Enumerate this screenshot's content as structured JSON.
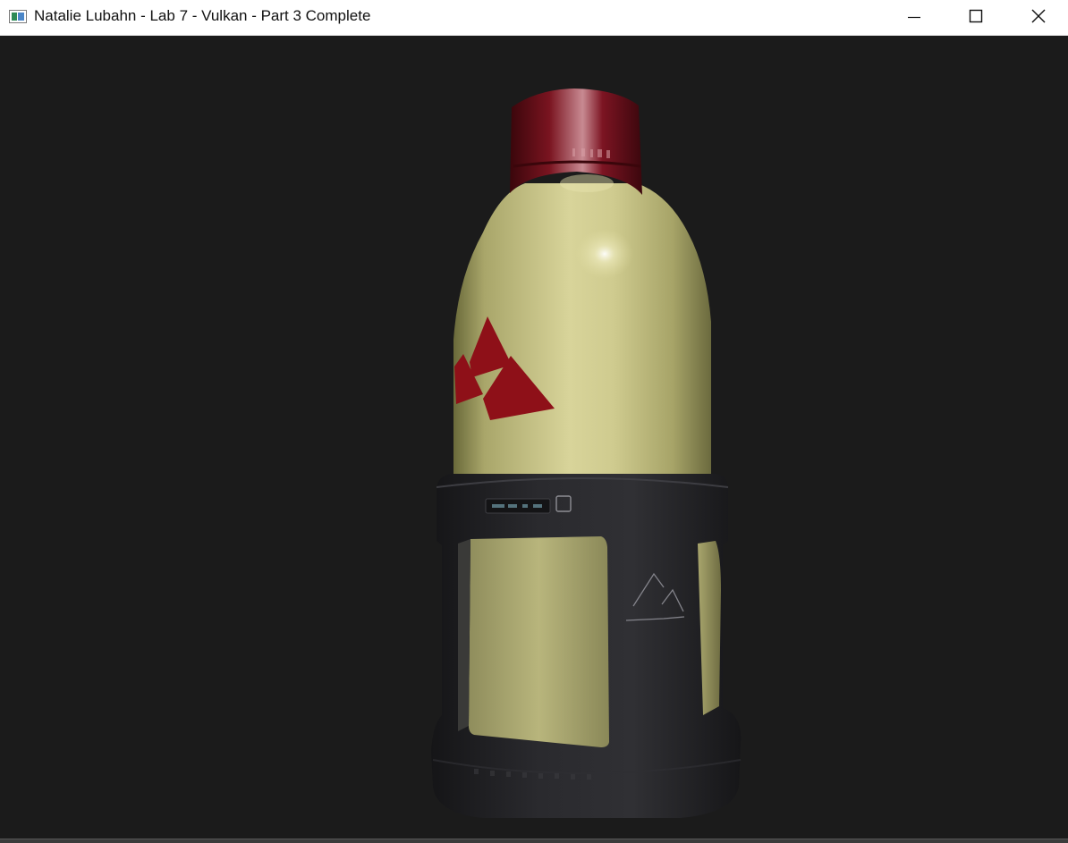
{
  "window": {
    "title": "Natalie Lubahn - Lab 7 - Vulkan - Part 3 Complete",
    "icon": "app-window-icon",
    "controls": {
      "minimize_icon": "minimize-icon",
      "maximize_icon": "maximize-icon",
      "close_icon": "close-icon"
    }
  },
  "viewport": {
    "background_color": "#1b1b1b",
    "model": {
      "object": "water bottle",
      "body_color": "#c9c68a",
      "cap_color": "#7a0f1a",
      "logo_color": "#8e1018",
      "sleeve_color": "#26262a"
    }
  }
}
